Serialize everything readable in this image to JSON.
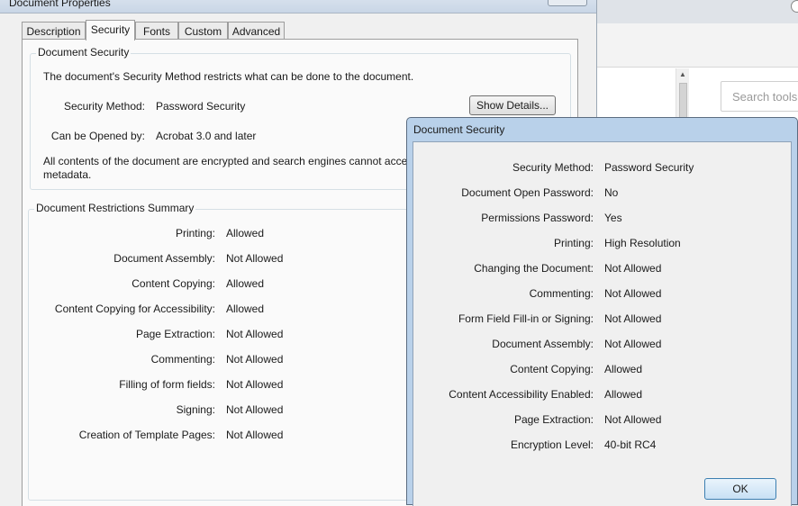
{
  "properties_dialog": {
    "title": "Document Properties",
    "tabs": [
      {
        "label": "Description",
        "active": false
      },
      {
        "label": "Security",
        "active": true
      },
      {
        "label": "Fonts",
        "active": false
      },
      {
        "label": "Custom",
        "active": false
      },
      {
        "label": "Advanced",
        "active": false
      }
    ],
    "security_group": {
      "legend": "Document Security",
      "intro": "The document's Security Method restricts what can be done to the document.",
      "method_label": "Security Method:",
      "method_value": "Password Security",
      "show_details_label": "Show Details...",
      "opened_by_label": "Can be Opened by:",
      "opened_by_value": "Acrobat 3.0 and later",
      "encryption_note_line1": "All contents of the document are encrypted and search engines cannot acces",
      "encryption_note_line2": "metadata."
    },
    "restrictions": {
      "legend": "Document Restrictions Summary",
      "rows": [
        {
          "label": "Printing:",
          "value": "Allowed"
        },
        {
          "label": "Document Assembly:",
          "value": "Not Allowed"
        },
        {
          "label": "Content Copying:",
          "value": "Allowed"
        },
        {
          "label": "Content Copying for Accessibility:",
          "value": "Allowed"
        },
        {
          "label": "Page Extraction:",
          "value": "Not Allowed"
        },
        {
          "label": "Commenting:",
          "value": "Not Allowed"
        },
        {
          "label": "Filling of form fields:",
          "value": "Not Allowed"
        },
        {
          "label": "Signing:",
          "value": "Not Allowed"
        },
        {
          "label": "Creation of Template Pages:",
          "value": "Not Allowed"
        }
      ]
    }
  },
  "security_dialog": {
    "title": "Document Security",
    "rows": [
      {
        "label": "Security Method:",
        "value": "Password Security"
      },
      {
        "label": "Document Open Password:",
        "value": "No"
      },
      {
        "label": "Permissions Password:",
        "value": "Yes"
      },
      {
        "label": "Printing:",
        "value": "High Resolution"
      },
      {
        "label": "Changing the Document:",
        "value": "Not Allowed"
      },
      {
        "label": "Commenting:",
        "value": "Not Allowed"
      },
      {
        "label": "Form Field Fill-in or Signing:",
        "value": "Not Allowed"
      },
      {
        "label": "Document Assembly:",
        "value": "Not Allowed"
      },
      {
        "label": "Content Copying:",
        "value": "Allowed"
      },
      {
        "label": "Content Accessibility Enabled:",
        "value": "Allowed"
      },
      {
        "label": "Page Extraction:",
        "value": "Not Allowed"
      },
      {
        "label": "Encryption Level:",
        "value": "40-bit RC4"
      }
    ],
    "ok_label": "OK"
  },
  "background_app": {
    "search_placeholder": "Search tools"
  }
}
